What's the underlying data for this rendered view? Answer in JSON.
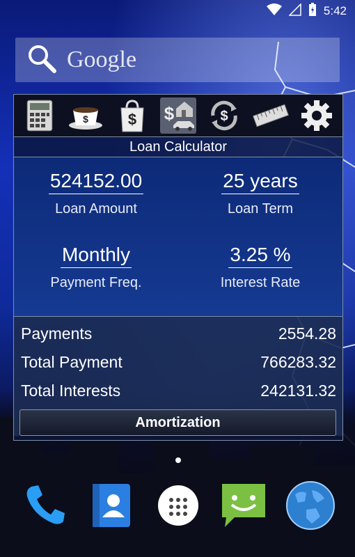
{
  "status_bar": {
    "time": "5:42"
  },
  "search": {
    "logo_text": "Google"
  },
  "widget": {
    "icons": [
      "calculator-icon",
      "coffee-tip-icon",
      "shopping-bag-icon",
      "loan-icon",
      "currency-exchange-icon",
      "ruler-icon",
      "gear-icon"
    ],
    "active_icon": "loan-icon",
    "title": "Loan Calculator",
    "loan_amount": {
      "value": "524152.00",
      "label": "Loan Amount"
    },
    "loan_term": {
      "value": "25 years",
      "label": "Loan Term"
    },
    "payment_freq": {
      "value": "Monthly",
      "label": "Payment Freq."
    },
    "interest_rate": {
      "value": "3.25 %",
      "label": "Interest Rate"
    },
    "results": [
      {
        "label": "Payments",
        "value": "2554.28"
      },
      {
        "label": "Total Payment",
        "value": "766283.32"
      },
      {
        "label": "Total Interests",
        "value": "242131.32"
      }
    ],
    "amortization_label": "Amortization"
  },
  "dock": [
    "phone-icon",
    "contacts-icon",
    "app-drawer-icon",
    "messaging-icon",
    "browser-globe-icon"
  ],
  "colors": {
    "accent": "#1430b8",
    "widget_bg": "#0d2a78"
  }
}
